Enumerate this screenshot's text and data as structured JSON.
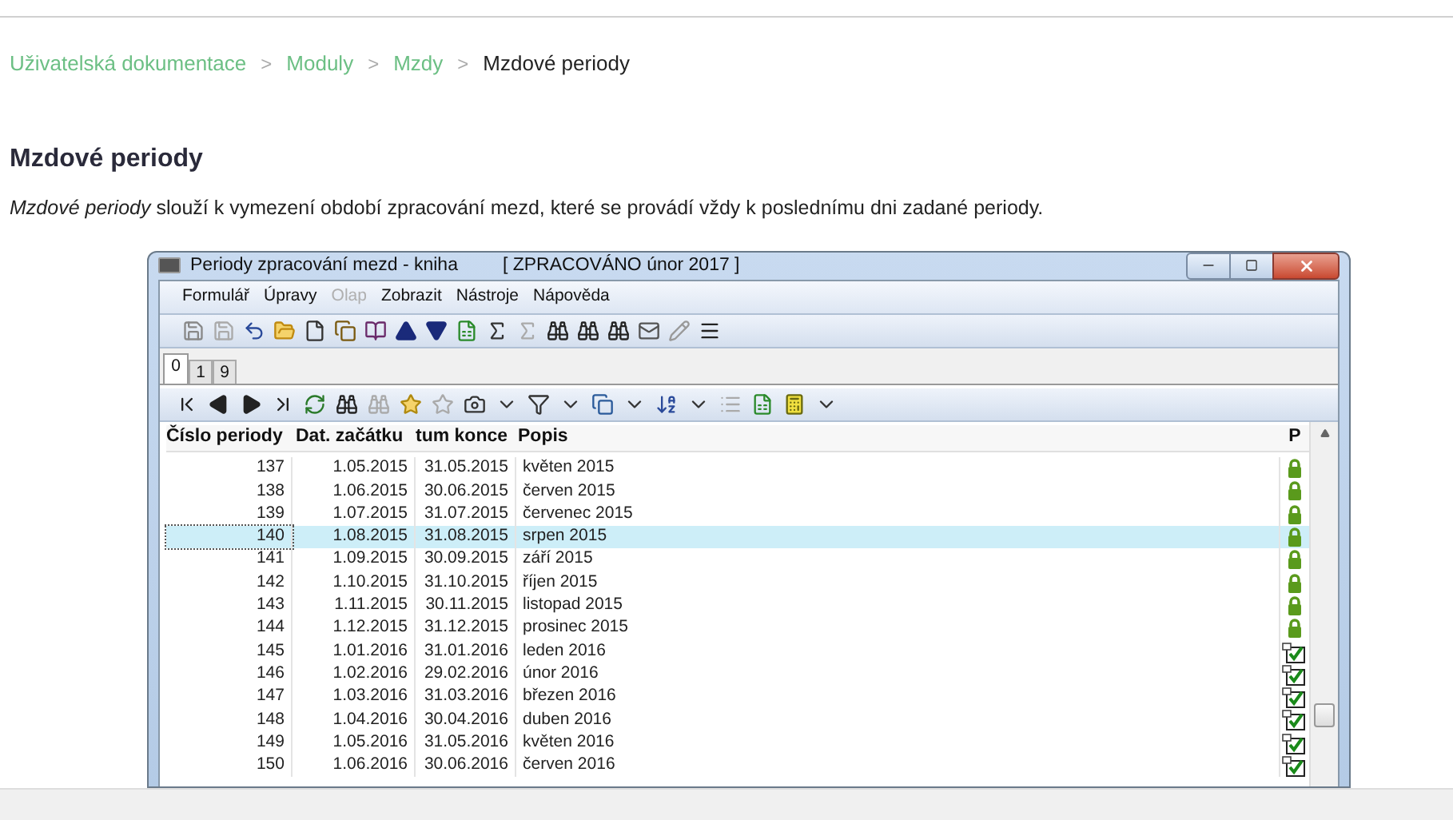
{
  "breadcrumb": [
    {
      "label": "Uživatelská dokumentace",
      "kind": "link"
    },
    {
      "label": "Moduly",
      "kind": "link"
    },
    {
      "label": "Mzdy",
      "kind": "link"
    },
    {
      "label": "Mzdové periody",
      "kind": "current"
    }
  ],
  "separator": ">",
  "heading": "Mzdové periody",
  "intro": "*Mzdové periody* slouží k vymezení období zpracování mezd, které se provádí vždy k poslednímu dni zadané periody.",
  "window": {
    "title": "Periody zpracování mezd - kniha",
    "status": "[ ZPRACOVÁNO únor 2017 ]",
    "menu": [
      {
        "label": "Formulář",
        "disabled": false
      },
      {
        "label": "Úpravy",
        "disabled": false
      },
      {
        "label": "Olap",
        "disabled": true
      },
      {
        "label": "Zobrazit",
        "disabled": false
      },
      {
        "label": "Nástroje",
        "disabled": false
      },
      {
        "label": "Nápověda",
        "disabled": false
      }
    ],
    "tabs": [
      {
        "label": "0",
        "selected": true
      },
      {
        "label": "1",
        "selected": false
      },
      {
        "label": "9",
        "selected": false
      }
    ],
    "table": {
      "columns": [
        "Číslo periody",
        "Dat. začátku",
        "tum konce",
        "Popis",
        "P"
      ],
      "rows": [
        {
          "cells": [
            "137",
            "1.05.2015",
            "31.05.2015",
            "květen 2015"
          ],
          "kind": "locked",
          "selected": false
        },
        {
          "cells": [
            "138",
            "1.06.2015",
            "30.06.2015",
            "červen 2015"
          ],
          "kind": "locked",
          "selected": false
        },
        {
          "cells": [
            "139",
            "1.07.2015",
            "31.07.2015",
            "červenec 2015"
          ],
          "kind": "locked",
          "selected": false
        },
        {
          "cells": [
            "140",
            "1.08.2015",
            "31.08.2015",
            "srpen 2015"
          ],
          "kind": "locked",
          "selected": true
        },
        {
          "cells": [
            "141",
            "1.09.2015",
            "30.09.2015",
            "září 2015"
          ],
          "kind": "locked",
          "selected": false
        },
        {
          "cells": [
            "142",
            "1.10.2015",
            "31.10.2015",
            "říjen 2015"
          ],
          "kind": "locked",
          "selected": false
        },
        {
          "cells": [
            "143",
            "1.11.2015",
            "30.11.2015",
            "listopad 2015"
          ],
          "kind": "locked",
          "selected": false
        },
        {
          "cells": [
            "144",
            "1.12.2015",
            "31.12.2015",
            "prosinec 2015"
          ],
          "kind": "locked",
          "selected": false
        },
        {
          "cells": [
            "145",
            "1.01.2016",
            "31.01.2016",
            "leden 2016"
          ],
          "kind": "closed",
          "selected": false
        },
        {
          "cells": [
            "146",
            "1.02.2016",
            "29.02.2016",
            "únor 2016"
          ],
          "kind": "closed",
          "selected": false
        },
        {
          "cells": [
            "147",
            "1.03.2016",
            "31.03.2016",
            "březen 2016"
          ],
          "kind": "closed",
          "selected": false
        },
        {
          "cells": [
            "148",
            "1.04.2016",
            "30.04.2016",
            "duben 2016"
          ],
          "kind": "closed",
          "selected": false
        },
        {
          "cells": [
            "149",
            "1.05.2016",
            "31.05.2016",
            "květen 2016"
          ],
          "kind": "closed",
          "selected": false
        },
        {
          "cells": [
            "150",
            "1.06.2016",
            "30.06.2016",
            "červen 2016"
          ],
          "kind": "closed",
          "selected": false
        }
      ]
    }
  }
}
